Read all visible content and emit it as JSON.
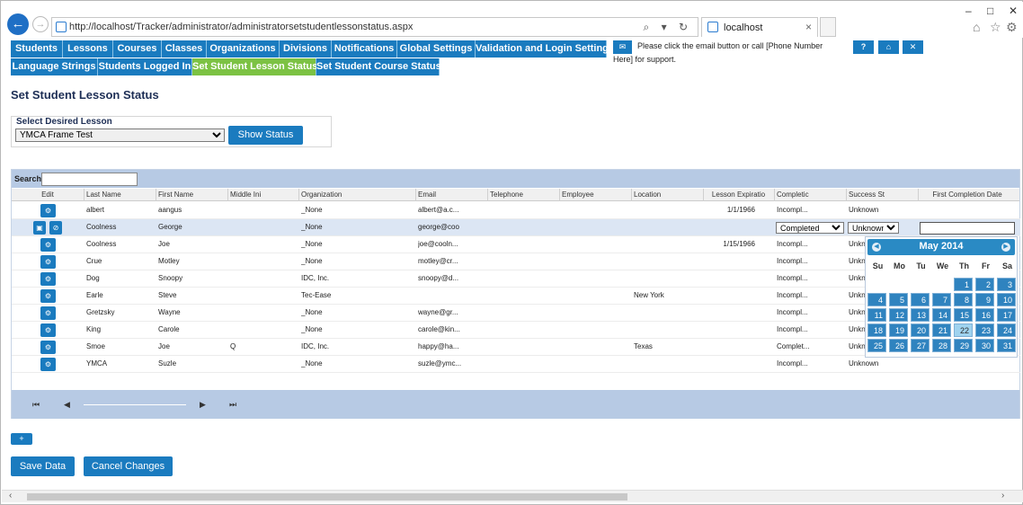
{
  "browser": {
    "url": "http://localhost/Tracker/administrator/administratorsetstudentlessonstatus.aspx",
    "tab_title": "localhost",
    "tab_close": "×",
    "window_controls": [
      "–",
      "□",
      "✕"
    ]
  },
  "nav": {
    "row1": [
      "Students",
      "Lessons",
      "Courses",
      "Classes",
      "Organizations",
      "Divisions",
      "Notifications",
      "Global Settings",
      "Validation and Login Settings"
    ],
    "row2": [
      "Language Strings",
      "Students Logged In",
      "Set Student Lesson Status",
      "Set Student Course Status"
    ],
    "active": "Set Student Lesson Status"
  },
  "support": {
    "text": "Please click the email button or call [Phone Number Here] for support.",
    "buttons": [
      "?",
      "⌂",
      "✕"
    ]
  },
  "page": {
    "title": "Set Student Lesson Status",
    "select_label": "Select Desired Lesson",
    "selected_lesson": "YMCA Frame Test",
    "show_status": "Show Status"
  },
  "grid": {
    "search_label": "Search:",
    "search_value": "",
    "columns": [
      "Edit",
      "Last Name",
      "First Name",
      "Middle Ini",
      "Organization",
      "Email",
      "Telephone",
      "Employee",
      "Location",
      "Lesson Expiratio",
      "Completic",
      "Success St",
      "First Completion Date"
    ],
    "rows": [
      {
        "last": "albert",
        "first": "aangus",
        "mi": "",
        "org": "_None",
        "email": "albert@a.c...",
        "phone": "",
        "emp": "",
        "loc": "",
        "exp": "1/1/1966",
        "comp": "Incompl...",
        "succ": "Unknown"
      },
      {
        "last": "Coolness",
        "first": "George",
        "mi": "",
        "org": "_None",
        "email": "george@coo",
        "phone": "",
        "emp": "",
        "loc": "",
        "exp": "",
        "comp": "Completed",
        "succ": "Unknown"
      },
      {
        "last": "Coolness",
        "first": "Joe",
        "mi": "",
        "org": "_None",
        "email": "joe@cooln...",
        "phone": "",
        "emp": "",
        "loc": "",
        "exp": "1/15/1966",
        "comp": "Incompl...",
        "succ": "Unkn"
      },
      {
        "last": "Crue",
        "first": "Motley",
        "mi": "",
        "org": "_None",
        "email": "motley@cr...",
        "phone": "",
        "emp": "",
        "loc": "",
        "exp": "",
        "comp": "Incompl...",
        "succ": "Unkn"
      },
      {
        "last": "Dog",
        "first": "Snoopy",
        "mi": "",
        "org": "IDC, Inc.",
        "email": "snoopy@d...",
        "phone": "",
        "emp": "",
        "loc": "",
        "exp": "",
        "comp": "Incompl...",
        "succ": "Unkn"
      },
      {
        "last": "Earle",
        "first": "Steve",
        "mi": "",
        "org": "Tec-Ease",
        "email": "",
        "phone": "",
        "emp": "",
        "loc": "New York",
        "exp": "",
        "comp": "Incompl...",
        "succ": "Unkn"
      },
      {
        "last": "Gretzsky",
        "first": "Wayne",
        "mi": "",
        "org": "_None",
        "email": "wayne@gr...",
        "phone": "",
        "emp": "",
        "loc": "",
        "exp": "",
        "comp": "Incompl...",
        "succ": "Unkn"
      },
      {
        "last": "King",
        "first": "Carole",
        "mi": "",
        "org": "_None",
        "email": "carole@kin...",
        "phone": "",
        "emp": "",
        "loc": "",
        "exp": "",
        "comp": "Incompl...",
        "succ": "Unkn"
      },
      {
        "last": "Smoe",
        "first": "Joe",
        "mi": "Q",
        "org": "IDC, Inc.",
        "email": "happy@ha...",
        "phone": "",
        "emp": "",
        "loc": "Texas",
        "exp": "",
        "comp": "Complet...",
        "succ": "Unkn"
      },
      {
        "last": "YMCA",
        "first": "Suzle",
        "mi": "",
        "org": "_None",
        "email": "suzle@ymc...",
        "phone": "",
        "emp": "",
        "loc": "",
        "exp": "",
        "comp": "Incompl...",
        "succ": "Unknown"
      }
    ],
    "editing_row": 1
  },
  "calendar": {
    "month_label": "May 2014",
    "weekdays": [
      "Su",
      "Mo",
      "Tu",
      "We",
      "Th",
      "Fr",
      "Sa"
    ],
    "first_weekday": 4,
    "days_in_month": 31,
    "highlighted_day": 22
  },
  "footer": {
    "add": "+",
    "save": "Save Data",
    "cancel": "Cancel Changes"
  }
}
